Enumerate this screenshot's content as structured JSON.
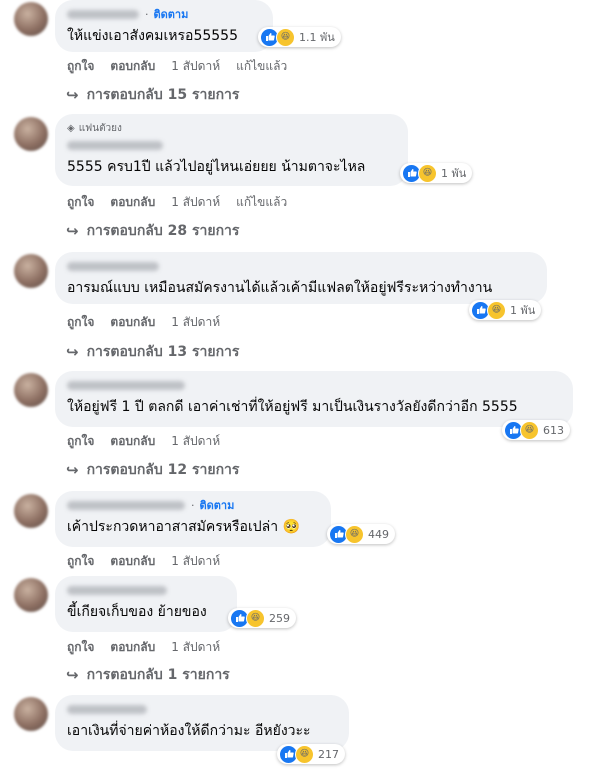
{
  "comments": [
    {
      "badge": "",
      "follow": "ติดตาม",
      "text": "ให้แข่งเอาสังคมเหรอ55555",
      "reaction_count": "1.1 พัน",
      "actions": [
        "ถูกใจ",
        "ตอบกลับ",
        "1 สัปดาห์",
        "แก้ไขแล้ว"
      ],
      "replies": "การตอบกลับ 15 รายการ"
    },
    {
      "badge": "แฟนตัวยง",
      "follow": "",
      "text": "5555 ครบ1ปี แล้วไปอยู่ไหนเอ่ยยย น้ามตาจะไหล",
      "reaction_count": "1 พัน",
      "actions": [
        "ถูกใจ",
        "ตอบกลับ",
        "1 สัปดาห์",
        "แก้ไขแล้ว"
      ],
      "replies": "การตอบกลับ 28 รายการ"
    },
    {
      "badge": "",
      "follow": "",
      "text": "อารมณ์แบบ เหมือนสมัครงานได้แล้วเค้ามีแฟลตให้อยู่ฟรีระหว่างทำงาน",
      "reaction_count": "1 พัน",
      "actions": [
        "ถูกใจ",
        "ตอบกลับ",
        "1 สัปดาห์"
      ],
      "replies": "การตอบกลับ 13 รายการ"
    },
    {
      "badge": "",
      "follow": "",
      "text": "ให้อยู่ฟรี 1 ปี ตลกดี เอาค่าเช่าที่ให้อยู่ฟรี มาเป็นเงินรางวัลยังดีกว่าอีก 5555",
      "reaction_count": "613",
      "actions": [
        "ถูกใจ",
        "ตอบกลับ",
        "1 สัปดาห์"
      ],
      "replies": "การตอบกลับ 12 รายการ"
    },
    {
      "badge": "",
      "follow": "ติดตาม",
      "text": "เค้าประกวดหาอาสาสมัครหรือเปล่า 🥺",
      "reaction_count": "449",
      "actions": [
        "ถูกใจ",
        "ตอบกลับ",
        "1 สัปดาห์"
      ],
      "replies": ""
    },
    {
      "badge": "",
      "follow": "",
      "text": "ขี้เกียจเก็บของ ย้ายของ",
      "reaction_count": "259",
      "actions": [
        "ถูกใจ",
        "ตอบกลับ",
        "1 สัปดาห์"
      ],
      "replies": "การตอบกลับ 1 รายการ"
    },
    {
      "badge": "",
      "follow": "",
      "text": "เอาเงินที่จ่ายค่าห้องให้ดีกว่ามะ อีหยังวะะ",
      "reaction_count": "217",
      "actions": [],
      "replies": ""
    }
  ],
  "icons": {
    "like": "like-icon",
    "haha": "haha-icon",
    "reply_arrow": "reply-arrow-icon",
    "fan_badge": "diamond-icon"
  },
  "colors": {
    "bubble": "#f0f2f5",
    "link": "#1877f2",
    "muted": "#65676b",
    "like": "#1877f2",
    "haha": "#f7c42d"
  }
}
